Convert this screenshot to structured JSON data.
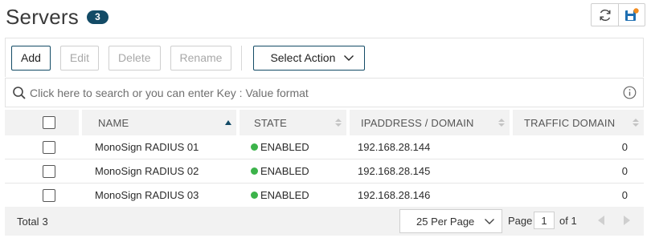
{
  "page": {
    "title": "Servers",
    "count": "3"
  },
  "top_icons": [
    "refresh-icon",
    "save-config-icon"
  ],
  "toolbar": {
    "add_label": "Add",
    "edit_label": "Edit",
    "delete_label": "Delete",
    "rename_label": "Rename",
    "select_action_label": "Select Action"
  },
  "search": {
    "placeholder": "Click here to search or you can enter Key : Value format"
  },
  "table": {
    "columns": {
      "name": "NAME",
      "state": "STATE",
      "ip": "IPADDRESS / DOMAIN",
      "traffic_domain": "TRAFFIC DOMAIN"
    },
    "rows": [
      {
        "name": "MonoSign RADIUS 01",
        "state": "ENABLED",
        "ip": "192.168.28.144",
        "traffic_domain": "0"
      },
      {
        "name": "MonoSign RADIUS 02",
        "state": "ENABLED",
        "ip": "192.168.28.145",
        "traffic_domain": "0"
      },
      {
        "name": "MonoSign RADIUS 03",
        "state": "ENABLED",
        "ip": "192.168.28.146",
        "traffic_domain": "0"
      }
    ]
  },
  "footer": {
    "total_label": "Total",
    "total_value": "3",
    "per_page": "25 Per Page",
    "page_label": "Page",
    "page_number": "1",
    "of_label": "of 1"
  },
  "colors": {
    "accent": "#134b66",
    "enabled": "#3cb34a",
    "save_dot": "#f28c1f"
  }
}
